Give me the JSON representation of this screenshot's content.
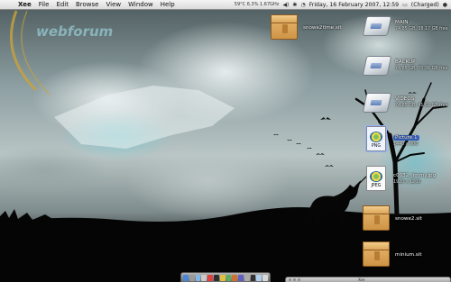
{
  "menubar": {
    "apple_glyph": "",
    "app_name": "Xee",
    "menus": [
      "File",
      "Edit",
      "Browse",
      "View",
      "Window",
      "Help"
    ],
    "stats": "59°C 6.3% 1.67GHz",
    "clock": "Friday, 16 February 2007, 12:59",
    "battery_status": "(Charged)"
  },
  "wallpaper": {
    "logo_text": "webforum"
  },
  "desktop_icons": [
    {
      "name": "snowe2time.sit",
      "sub": "",
      "type": "archive"
    },
    {
      "name": "MAIN",
      "sub": "74.85 GB, 38.17 GB free",
      "type": "disk"
    },
    {
      "name": "BACKUP",
      "sub": "74.85 GB, 70.38 GB free",
      "type": "disk"
    },
    {
      "name": "VIDEOS",
      "sub": "74.85 GB, 41.61 GB free",
      "type": "disk"
    },
    {
      "name": "Picture 1",
      "sub": "1440 x 900",
      "type": "PNG"
    },
    {
      "name": "c0032_Jimmy.jpg",
      "sub": "1920 x 1200",
      "type": "JPEG"
    },
    {
      "name": "snowe2.sit",
      "sub": "",
      "type": "archive"
    },
    {
      "name": "minium.sit",
      "sub": "",
      "type": "archive"
    }
  ],
  "mini_window": {
    "title": "Xee"
  },
  "colors": {
    "menubar_top": "#f4f4f4",
    "menubar_bottom": "#dadada",
    "selection_blue": "#3a67c9",
    "sky_teal": "#6ecdd7",
    "box_orange": "#dba75a"
  },
  "icons": {
    "apple": "apple-icon",
    "volume": "volume-icon",
    "wifi": "wifi-icon",
    "bluetooth": "bluetooth-icon",
    "battery": "battery-icon",
    "spotlight": "spotlight-icon"
  }
}
